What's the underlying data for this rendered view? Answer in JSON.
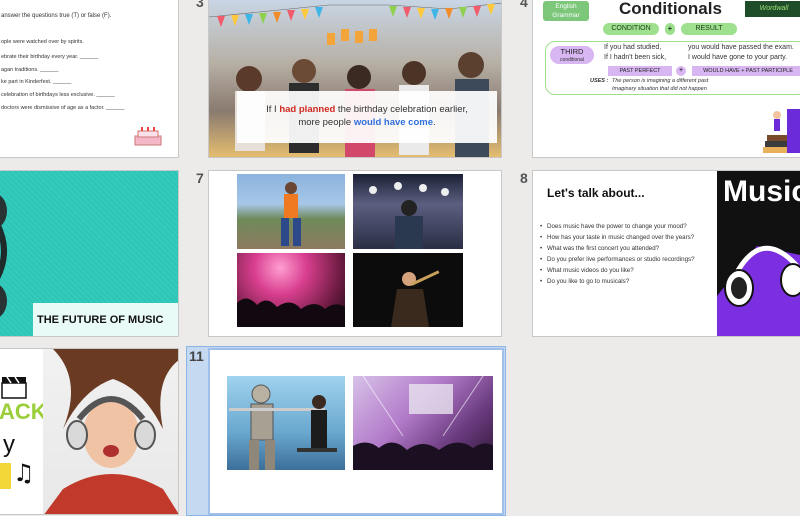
{
  "slides": {
    "s2": {
      "lines": [
        "answer the questions true (T) or false (F).",
        "ople were watched over by spirits.",
        "ebrate their birthday every year. ______",
        "agan traditions. ______",
        "ke part in Kinderfest. ______",
        "celebration of birthdays less exclusive. ______",
        "doctors were dismissive of age as a factor. ______"
      ]
    },
    "s3": {
      "number": "3",
      "caption_pre": "If I ",
      "caption_red": "had planned",
      "caption_mid": " the birthday celebration earlier,",
      "caption_line2_pre": "more people ",
      "caption_blue": "would have come",
      "caption_end": "."
    },
    "s4": {
      "number": "4",
      "badge": "English Grammar",
      "title": "Conditionals",
      "logo": "Wordwall",
      "condition": "CONDITION",
      "plus": "+",
      "result": "RESULT",
      "third": "THIRD",
      "third_sub": "conditional",
      "ex1": "If you had studied,",
      "ex2": "If I hadn't been sick,",
      "res1": "you would have passed the exam.",
      "res2": "I would have gone to your party.",
      "past_perfect": "PAST PERFECT",
      "would_have": "WOULD HAVE + PAST PARTICIPLE",
      "uses_label": "USES :",
      "use1": "The person is imagining a different past",
      "use2": "Imaginary situation that did not happen"
    },
    "s6": {
      "title": "THE FUTURE OF MUSIC"
    },
    "s7": {
      "number": "7"
    },
    "s8": {
      "number": "8",
      "heading": "Let's talk about...",
      "questions": [
        "Does music have the power to change your mood?",
        "How has your taste in music changed over the years?",
        "What was the first concert you attended?",
        "Do you prefer live performances or studio recordings?",
        "What music videos do you like?",
        "Do you like to go to musicals?"
      ],
      "side_title": "Music"
    },
    "s10": {
      "letters1": "ACK",
      "letters2": "y"
    },
    "s11": {
      "number": "11"
    }
  },
  "colors": {
    "selected_border": "#8ab4e8",
    "selected_panel": "#c5d9f1",
    "accent_green": "#7cc77a",
    "teal": "#2ec4b6",
    "red_text": "#d0281f",
    "blue_text": "#2f6fdc",
    "purple": "#6c2bd9"
  }
}
